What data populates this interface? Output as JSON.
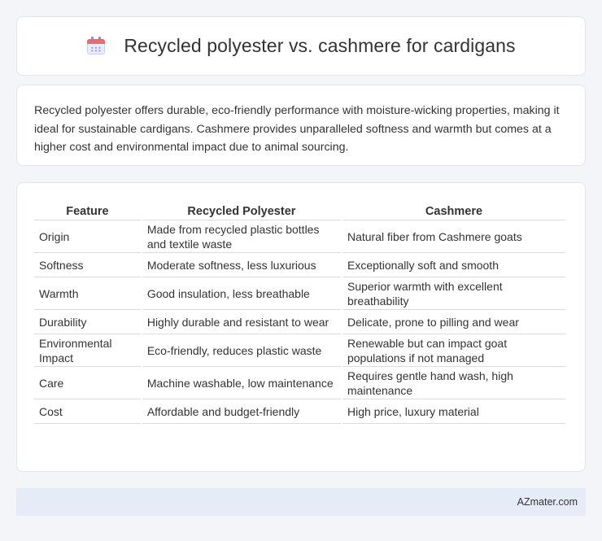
{
  "header": {
    "icon": "calendar-icon",
    "title": "Recycled polyester vs. cashmere for cardigans"
  },
  "summary": "Recycled polyester offers durable, eco-friendly performance with moisture-wicking properties, making it ideal for sustainable cardigans. Cashmere provides unparalleled softness and warmth but comes at a higher cost and environmental impact due to animal sourcing.",
  "table": {
    "headers": [
      "Feature",
      "Recycled Polyester",
      "Cashmere"
    ],
    "rows": [
      [
        "Origin",
        "Made from recycled plastic bottles and textile waste",
        "Natural fiber from Cashmere goats"
      ],
      [
        "Softness",
        "Moderate softness, less luxurious",
        "Exceptionally soft and smooth"
      ],
      [
        "Warmth",
        "Good insulation, less breathable",
        "Superior warmth with excellent breathability"
      ],
      [
        "Durability",
        "Highly durable and resistant to wear",
        "Delicate, prone to pilling and wear"
      ],
      [
        "Environmental Impact",
        "Eco-friendly, reduces plastic waste",
        "Renewable but can impact goat populations if not managed"
      ],
      [
        "Care",
        "Machine washable, low maintenance",
        "Requires gentle hand wash, high maintenance"
      ],
      [
        "Cost",
        "Affordable and budget-friendly",
        "High price, luxury material"
      ]
    ]
  },
  "footer": {
    "source": "AZmater.com"
  }
}
